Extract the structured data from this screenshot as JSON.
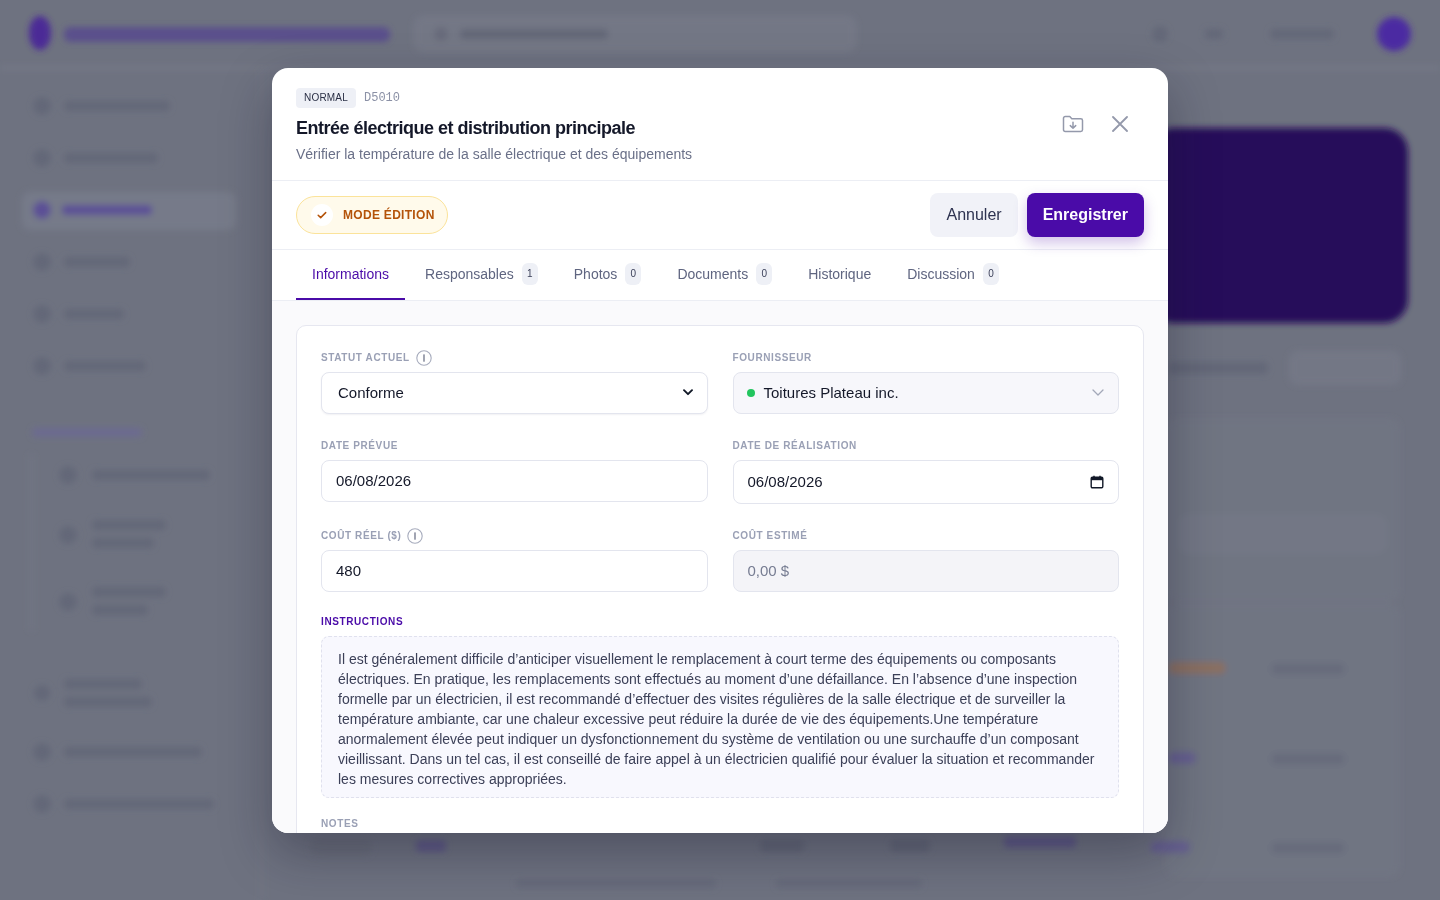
{
  "header": {
    "priority_badge": "NORMAL",
    "code": "D5010",
    "title": "Entrée électrique et distribution principale",
    "subtitle": "Vérifier la température de la salle électrique et des équipements"
  },
  "toolbar": {
    "edit_mode": {
      "label": "MODE ÉDITION",
      "on": true
    },
    "buttons": [
      {
        "label": "Annuler",
        "kind": "secondary"
      },
      {
        "label": "Enregistrer",
        "kind": "primary"
      }
    ]
  },
  "tabs": [
    {
      "label": "Informations",
      "selected": true
    },
    {
      "label": "Responsables",
      "count": "1",
      "selected": false
    },
    {
      "label": "Photos",
      "count": "0",
      "selected": false
    },
    {
      "label": "Documents",
      "count": "0",
      "selected": false
    },
    {
      "label": "Historique",
      "selected": false
    },
    {
      "label": "Discussion",
      "count": "0",
      "selected": false
    }
  ],
  "form": {
    "fields": [
      {
        "label": "STATUT ACTUEL",
        "kind": "select",
        "value": "Conforme",
        "info": true,
        "disabled": false
      },
      {
        "label": "FOURNISSEUR",
        "kind": "combo",
        "value": "Toitures Plateau inc.",
        "color": "#22c55e",
        "info": false,
        "disabled": false
      },
      {
        "label": "DATE PRÉVUE",
        "kind": "text",
        "value": "06/08/2026",
        "info": false,
        "disabled": false
      },
      {
        "label": "DATE DE RÉALISATION",
        "kind": "date",
        "value": "06/08/2026",
        "info": false,
        "disabled": false
      },
      {
        "label": "COÛT RÉEL ($)",
        "kind": "text",
        "value": "480",
        "info": true,
        "disabled": false
      },
      {
        "label": "COÛT ESTIMÉ",
        "kind": "text",
        "value": "0,00 $",
        "info": false,
        "disabled": true
      }
    ],
    "instructions": {
      "label": "INSTRUCTIONS",
      "text": "Il est généralement difficile d’anticiper visuellement le remplacement à court terme des équipements ou composants électriques. En pratique, les remplacements sont effectués au moment d’une défaillance. En l’absence d’une inspection formelle par un électricien, il est recommandé d’effectuer des visites régulières de la salle électrique et de surveiller la température ambiante, car une chaleur excessive peut réduire la durée de vie des équipements.Une température anormalement élevée peut indiquer un dysfonctionnement du système de ventilation ou une surchauffe d’un composant vieillissant. Dans un tel cas, il est conseillé de faire appel à un électricien qualifié pour évaluer la situation et recommander les mesures correctives appropriées."
    },
    "notes": {
      "label": "NOTES"
    }
  }
}
